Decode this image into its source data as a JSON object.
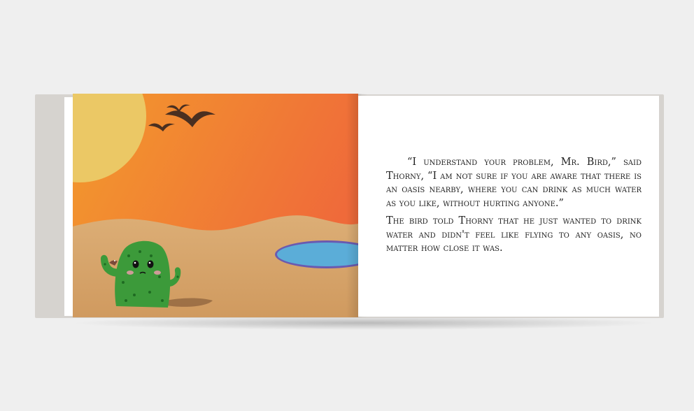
{
  "book": {
    "right_page": {
      "paragraphs": [
        "“I understand your problem, Mr. Bird,” said Thorny, “I am not sure if you are aware that there is an oasis nearby, where you can drink as much water as you like, without hurting anyone.”",
        "The bird told Thorny that he just wanted to drink water and didn't feel like flying to any oasis, no matter how close it was."
      ]
    },
    "illustration": {
      "sky_color": "#f07a2c",
      "sun_color": "#ebc865",
      "sand_color": "#d8aa72",
      "oasis_color": "#5badd8",
      "cactus_color": "#3c9a3a"
    }
  }
}
